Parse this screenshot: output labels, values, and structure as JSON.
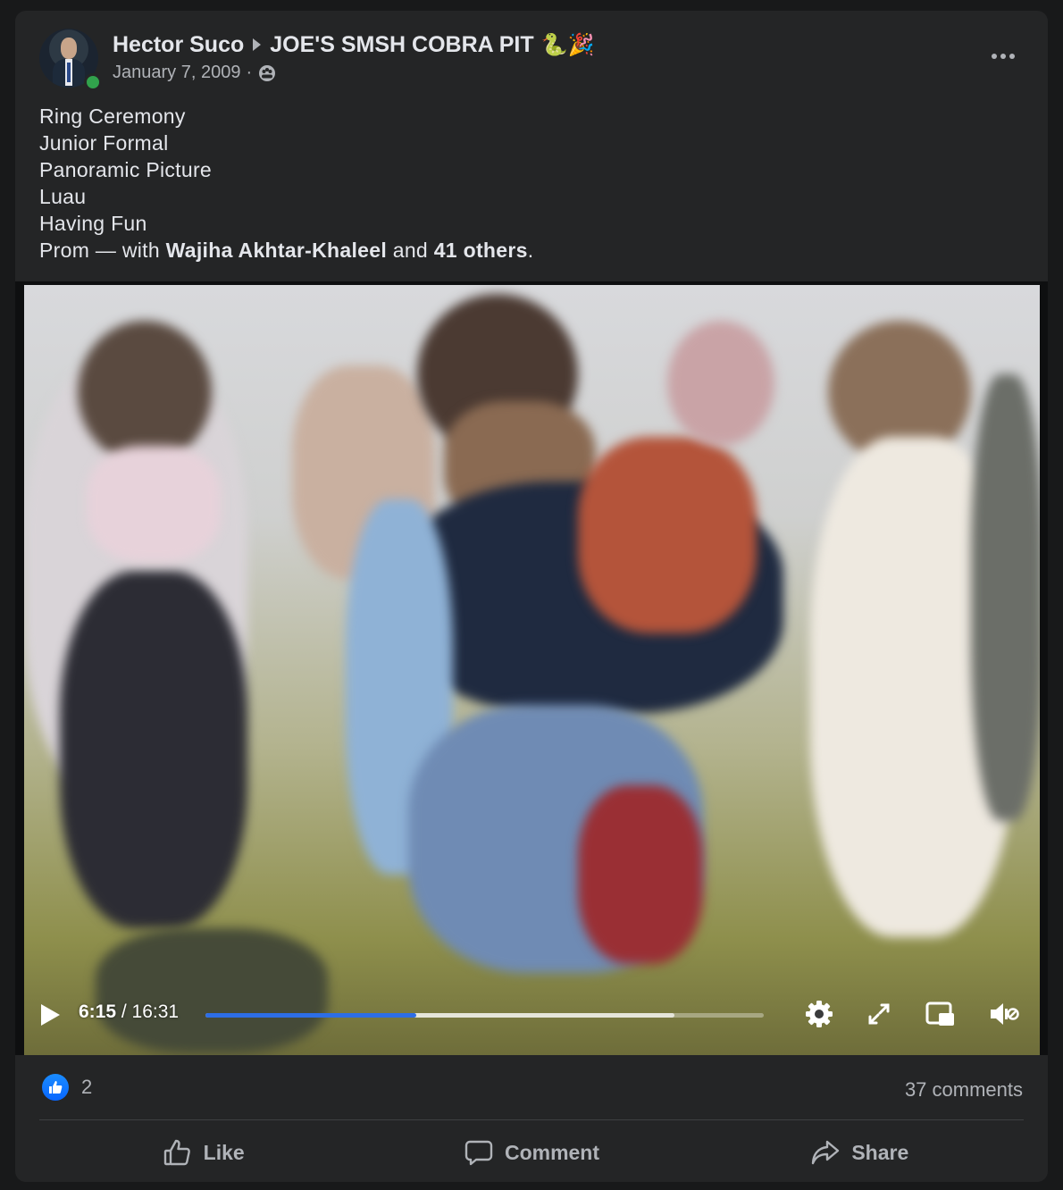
{
  "post": {
    "author": "Hector Suco",
    "group": "JOE'S SMSH COBRA PIT",
    "group_emoji": "🐍🎉",
    "date": "January 7, 2009",
    "date_separator": "·",
    "privacy_icon": "group-privacy-icon",
    "caption_lines": [
      "Ring Ceremony",
      "Junior Formal",
      "Panoramic Picture",
      "Luau",
      "Having Fun"
    ],
    "tag_line": {
      "prefix": "Prom — with ",
      "tagged_name": "Wajiha Akhtar-Khaleel",
      "middle": " and ",
      "others": "41 others",
      "suffix": "."
    }
  },
  "video": {
    "current_time": "6:15",
    "time_separator": " / ",
    "duration": "16:31",
    "progress_played": 0.378,
    "progress_buffered": 0.84,
    "accent_color": "#2d6ee6",
    "icons": [
      "play-icon",
      "settings-gear-icon",
      "fullscreen-icon",
      "picture-in-picture-icon",
      "volume-muted-icon"
    ]
  },
  "footer": {
    "reaction_count": "2",
    "comments": "37 comments",
    "actions": {
      "like": "Like",
      "comment": "Comment",
      "share": "Share"
    }
  }
}
